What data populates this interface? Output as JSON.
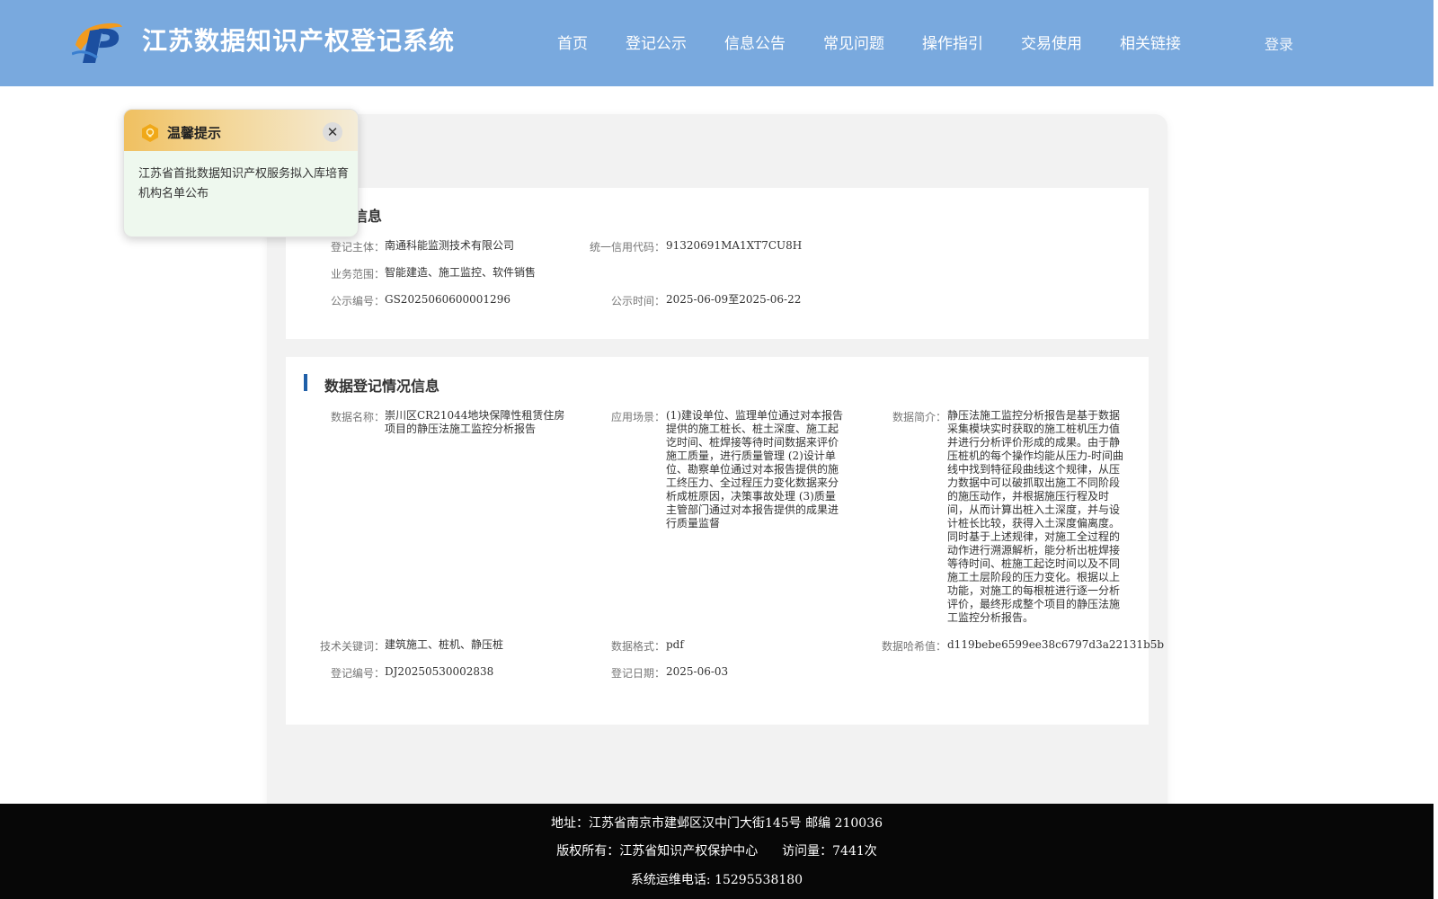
{
  "header": {
    "site_title": "江苏数据知识产权登记系统",
    "nav": [
      "首页",
      "登记公示",
      "信息公告",
      "常见问题",
      "操作指引",
      "交易使用",
      "相关链接"
    ],
    "login": "登录"
  },
  "basic_info": {
    "title": "基本信息",
    "subject_label": "登记主体：",
    "subject": "南通科能监测技术有限公司",
    "credit_code_label": "统一信用代码：",
    "credit_code": "91320691MA1XT7CU8H",
    "scope_label": "业务范围：",
    "scope": "智能建造、施工监控、软件销售",
    "notice_no_label": "公示编号：",
    "notice_no": "GS2025060600001296",
    "notice_time_label": "公示时间：",
    "notice_time": "2025-06-09至2025-06-22"
  },
  "registration_info": {
    "title": "数据登记情况信息",
    "name_label": "数据名称：",
    "name": "崇川区CR21044地块保障性租赁住房项目的静压法施工监控分析报告",
    "scenario_label": "应用场景：",
    "scenario": "(1)建设单位、监理单位通过对本报告提供的施工桩长、桩土深度、施工起讫时间、桩焊接等待时间数据来评价施工质量，进行质量管理 (2)设计单位、勘察单位通过对本报告提供的施工终压力、全过程压力变化数据来分析成桩原因，决策事故处理 (3)质量主管部门通过对本报告提供的成果进行质量监督",
    "intro_label": "数据简介：",
    "intro": "静压法施工监控分析报告是基于数据采集模块实时获取的施工桩机压力值并进行分析评价形成的成果。由于静压桩机的每个操作均能从压力-时间曲线中找到特征段曲线这个规律，从压力数据中可以破抓取出施工不同阶段的施压动作，并根据施压行程及时间，从而计算出桩入土深度，并与设计桩长比较，获得入土深度偏离度。同时基于上述规律，对施工全过程的动作进行溯源解析，能分析出桩焊接等待时间、桩施工起讫时间以及不同施工土层阶段的压力变化。根据以上功能，对施工的每根桩进行逐一分析评价，最终形成整个项目的静压法施工监控分析报告。",
    "keywords_label": "技术关键词：",
    "keywords": "建筑施工、桩机、静压桩",
    "format_label": "数据格式：",
    "format": "pdf",
    "hash_label": "数据哈希值：",
    "hash": "d119bebe6599ee38c6797d3a22131b5b",
    "reg_no_label": "登记编号：",
    "reg_no": "DJ20250530002838",
    "reg_date_label": "登记日期：",
    "reg_date": "2025-06-03"
  },
  "footer": {
    "address": "地址：江苏省南京市建邺区汉中门大街145号 邮编 210036",
    "copyright": "版权所有：江苏省知识产权保护中心",
    "visits": "访问量：7441次",
    "phone": "系统运维电话: 15295538180"
  },
  "toast": {
    "title": "温馨提示",
    "close": "✕",
    "body": "江苏省首批数据知识产权服务拟入库培育机构名单公布"
  },
  "icons": {
    "logo": "brand-logo",
    "toast": "lightbulb-icon",
    "close": "close-icon"
  },
  "colors": {
    "header": "#79a9de",
    "section_accent": "#1f5fa8",
    "footer": "#070707"
  }
}
